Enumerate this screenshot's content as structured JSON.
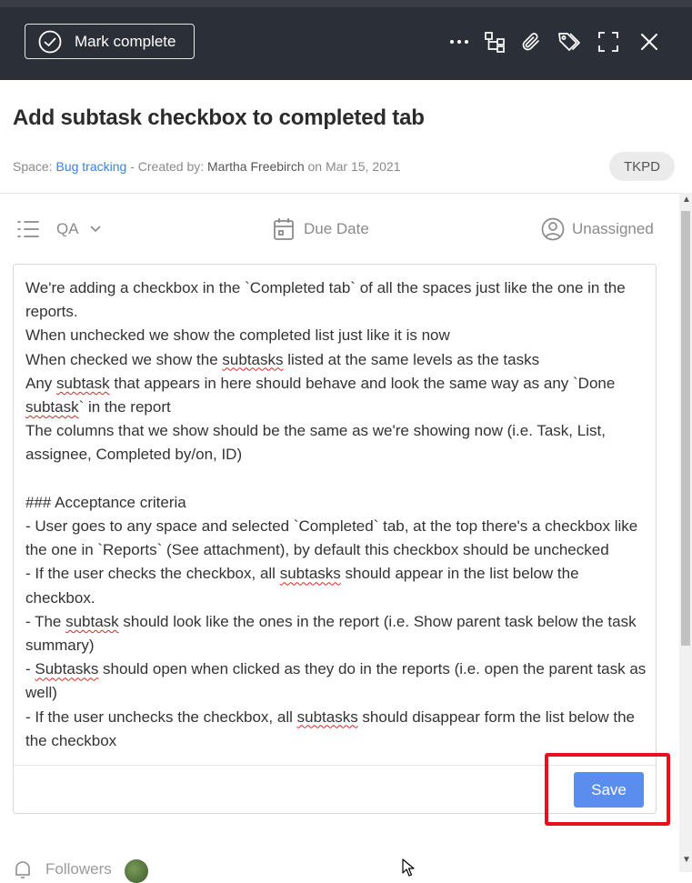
{
  "toolbar": {
    "mark_complete_label": "Mark complete"
  },
  "task": {
    "title": "Add subtask checkbox to completed tab",
    "meta": {
      "space_prefix": "Space: ",
      "space_name": "Bug tracking",
      "created_prefix": " - Created by: ",
      "creator": "Martha Freebirch",
      "date_text": " on Mar 15, 2021"
    },
    "tag": "TKPD"
  },
  "properties": {
    "list": "QA",
    "due_date": "Due Date",
    "assignee": "Unassigned"
  },
  "description": {
    "lines": [
      [
        {
          "t": "We're adding a checkbox in the `Completed tab` of all the spaces just like the one in the"
        }
      ],
      [
        {
          "t": "reports."
        }
      ],
      [
        {
          "t": "When unchecked we show the completed list just like it is now"
        }
      ],
      [
        {
          "t": "When checked we show the "
        },
        {
          "t": "subtasks",
          "sp": true
        },
        {
          "t": " listed at the same levels as the tasks"
        }
      ],
      [
        {
          "t": "Any "
        },
        {
          "t": "subtask",
          "sp": true
        },
        {
          "t": " that appears in here should behave and look the same way as any `Done"
        }
      ],
      [
        {
          "t": "subtask",
          "sp": true
        },
        {
          "t": "` in the report"
        }
      ],
      [
        {
          "t": "The columns that we show should be the same as we're showing now (i.e. Task, List,"
        }
      ],
      [
        {
          "t": "assignee, Completed by/on, ID)"
        }
      ],
      [
        {
          "t": " "
        }
      ],
      [
        {
          "t": "### Acceptance criteria"
        }
      ],
      [
        {
          "t": "- User goes to any space and selected `Completed` tab, at the top there's a checkbox like"
        }
      ],
      [
        {
          "t": "the one in `Reports` (See attachment), by default this checkbox should be unchecked"
        }
      ],
      [
        {
          "t": "- If the user checks the checkbox, all "
        },
        {
          "t": "subtasks",
          "sp": true
        },
        {
          "t": " should appear in the list below the"
        }
      ],
      [
        {
          "t": "checkbox."
        }
      ],
      [
        {
          "t": "- The "
        },
        {
          "t": "subtask",
          "sp": true
        },
        {
          "t": " should look like the ones in the report (i.e. Show parent task below the task"
        }
      ],
      [
        {
          "t": "summary)"
        }
      ],
      [
        {
          "t": "- "
        },
        {
          "t": "Subtasks",
          "sp": true
        },
        {
          "t": " should open when clicked as they do in the reports (i.e. open the parent task as"
        }
      ],
      [
        {
          "t": "well)"
        }
      ],
      [
        {
          "t": "- If the user unchecks the checkbox, all "
        },
        {
          "t": "subtasks",
          "sp": true
        },
        {
          "t": " should disappear form the list below the"
        }
      ],
      [
        {
          "t": "the checkbox"
        }
      ]
    ]
  },
  "editor": {
    "save_label": "Save"
  },
  "followers": {
    "label": "Followers"
  },
  "colors": {
    "toolbar_bg": "#2b2f38",
    "link": "#3b82e6",
    "save_button": "#5b8def",
    "highlight": "#e8101c"
  }
}
